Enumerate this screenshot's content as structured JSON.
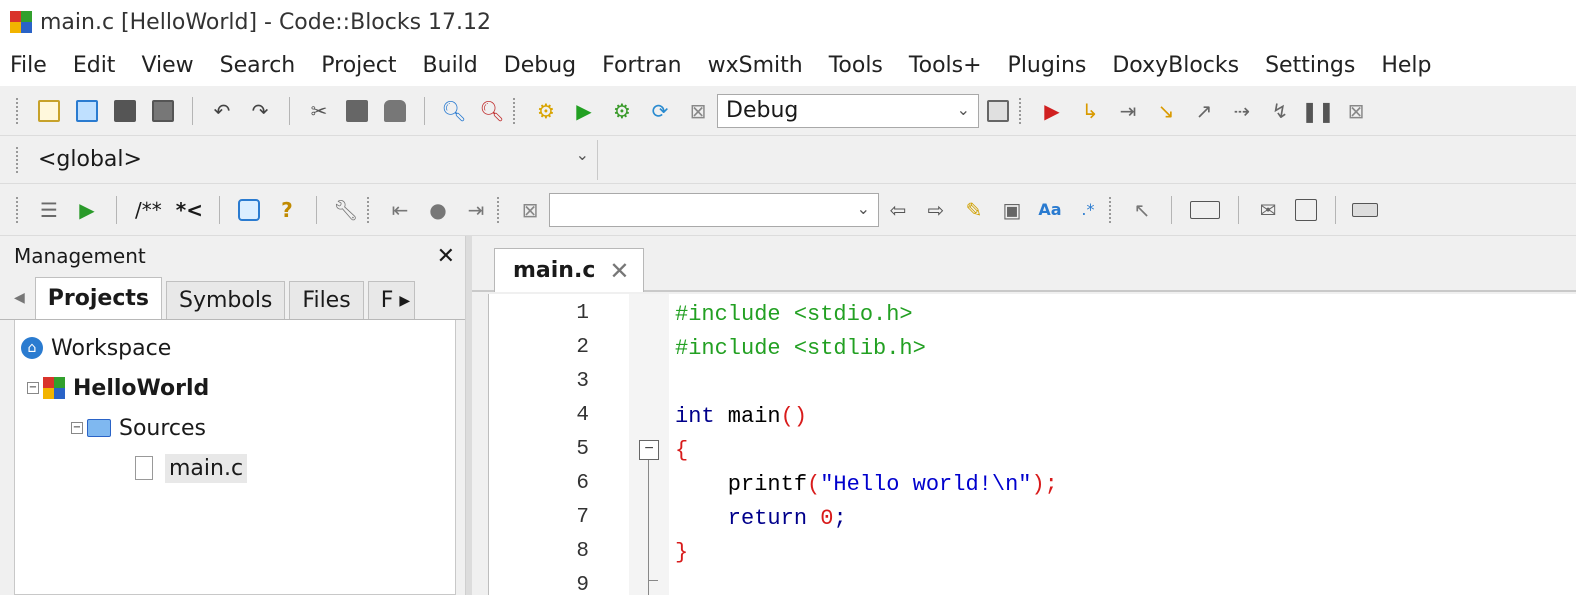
{
  "window": {
    "title": "main.c [HelloWorld] - Code::Blocks 17.12"
  },
  "menu": [
    "File",
    "Edit",
    "View",
    "Search",
    "Project",
    "Build",
    "Debug",
    "Fortran",
    "wxSmith",
    "Tools",
    "Tools+",
    "Plugins",
    "DoxyBlocks",
    "Settings",
    "Help"
  ],
  "toolbar": {
    "build_target": "Debug",
    "scope": "<global>",
    "doxy_comment": "/**",
    "doxy_line": "*<",
    "search_value": ""
  },
  "management": {
    "title": "Management",
    "close": "✕",
    "tabs": [
      "Projects",
      "Symbols",
      "Files",
      "F"
    ],
    "tree": {
      "workspace": "Workspace",
      "project": "HelloWorld",
      "sources": "Sources",
      "file": "main.c"
    }
  },
  "editor": {
    "tab_label": "main.c",
    "tab_close": "✕",
    "line_numbers": [
      "1",
      "2",
      "3",
      "4",
      "5",
      "6",
      "7",
      "8",
      "9"
    ],
    "lines": {
      "l1": "#include <stdio.h>",
      "l2": "#include <stdlib.h>",
      "l4_kw": "int",
      "l4_name": " main",
      "l4_paren": "()",
      "l5": "{",
      "l6_fn": "    printf",
      "l6_open": "(",
      "l6_str": "\"Hello world!\\n\"",
      "l6_close": ");",
      "l7_kw": "    return",
      "l7_num": " 0",
      "l7_semi": ";",
      "l8": "}"
    }
  },
  "colors": {
    "accent_red": "#d81b1b",
    "preprocessor": "#22a022",
    "keyword": "#00008b",
    "string": "#0000cd"
  }
}
